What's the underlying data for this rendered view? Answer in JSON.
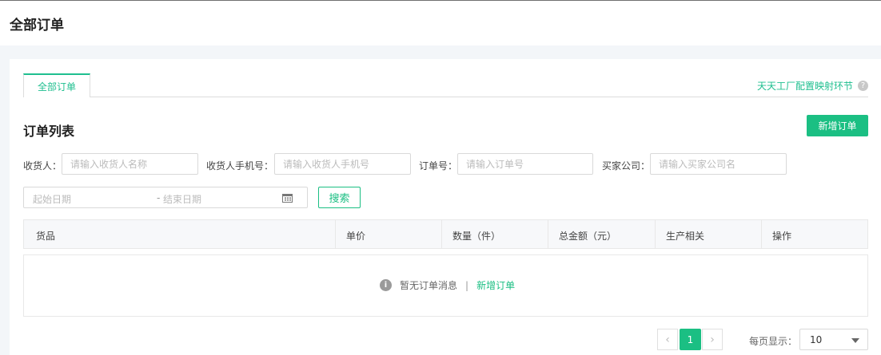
{
  "header": {
    "title": "全部订单"
  },
  "tabs": [
    {
      "label": "全部订单"
    }
  ],
  "config_link": "天天工厂配置映射环节",
  "list": {
    "title": "订单列表",
    "add_button": "新增订单"
  },
  "filters": {
    "receiver": {
      "label": "收货人：",
      "placeholder": "请输入收货人名称"
    },
    "phone": {
      "label": "收货人手机号：",
      "placeholder": "请输入收货人手机号"
    },
    "order_no": {
      "label": "订单号：",
      "placeholder": "请输入订单号"
    },
    "company": {
      "label": "买家公司：",
      "placeholder": "请输入买家公司名"
    },
    "date_start": "起始日期",
    "date_sep": "-",
    "date_end": "结束日期",
    "search_button": "搜索"
  },
  "table": {
    "columns": [
      "货品",
      "单价",
      "数量（件）",
      "总金额（元）",
      "生产相关",
      "操作"
    ],
    "empty_text": "暂无订单消息",
    "empty_divider": "|",
    "empty_action": "新增订单"
  },
  "pagination": {
    "prev": "‹",
    "current": "1",
    "next": "›",
    "page_size_label": "每页显示：",
    "page_size": "10"
  },
  "colors": {
    "accent": "#1bbf83"
  },
  "icons": {
    "help": "help-icon",
    "info": "info-icon",
    "calendar": "calendar-icon",
    "dropdown": "chevron-down-icon"
  }
}
